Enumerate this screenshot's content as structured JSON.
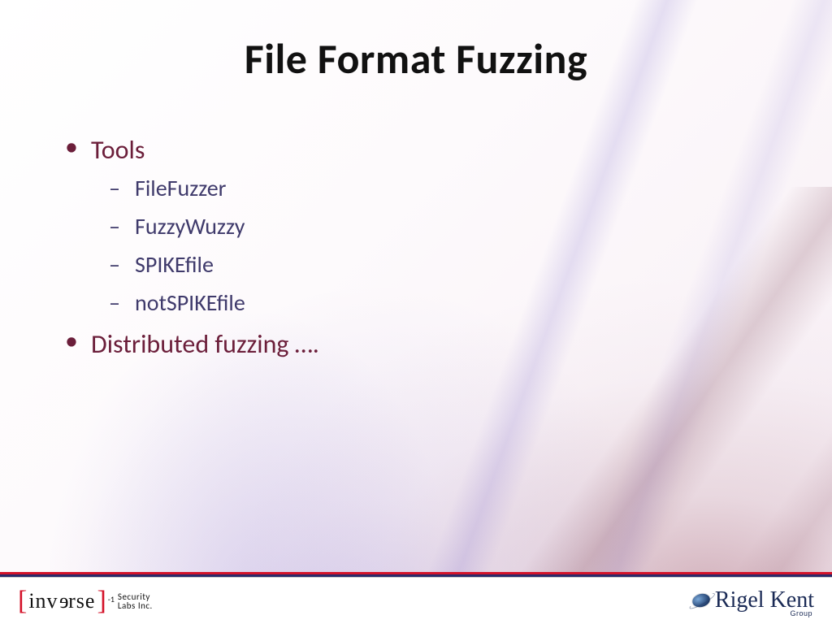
{
  "title": "File Format Fuzzing",
  "bullets": {
    "tools_label": "Tools",
    "tools_items": {
      "0": "FileFuzzer",
      "1": "FuzzyWuzzy",
      "2": "SPIKEfile",
      "3": "notSPIKEfile"
    },
    "distributed_label": "Distributed fuzzing …."
  },
  "footer": {
    "left": {
      "word_plain": "inv",
      "word_flip": "e",
      "word_rest": "rse",
      "sup": "-1",
      "line1": "Security",
      "line2": "Labs Inc."
    },
    "right": {
      "script": "Rigel Kent",
      "group": "Group"
    }
  }
}
